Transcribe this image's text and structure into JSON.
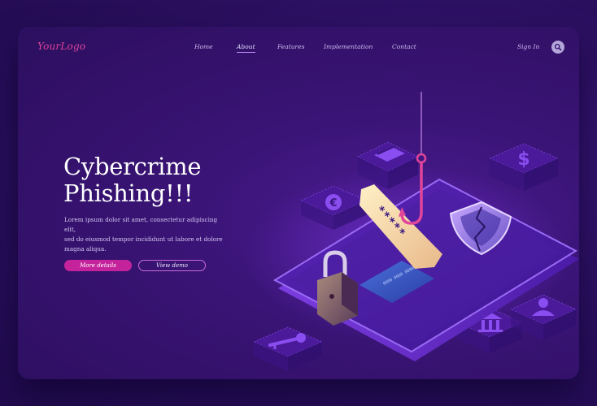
{
  "header": {
    "logo": "YourLogo",
    "nav": [
      "Home",
      "About",
      "Features",
      "Implementation",
      "Contact"
    ],
    "active_nav": "About",
    "sign_in": "Sign In"
  },
  "hero": {
    "title_line1": "Cybercrime",
    "title_line2": "Phishing!!!",
    "body_line1": "Lorem ipsum dolor sit amet, consectetur adipiscing elit,",
    "body_line2": "sed do eiusmod tempor incididunt ut labore et dolore",
    "body_line3": "magna aliqua.",
    "primary_button": "More details",
    "secondary_button": "View demo"
  },
  "illustration": {
    "password_mask": "*****",
    "icons": [
      "credit-card-icon",
      "dollar-icon",
      "euro-icon",
      "key-icon",
      "bank-icon",
      "user-icon",
      "padlock-icon",
      "broken-shield-icon",
      "fishing-hook-icon",
      "smartphone-icon"
    ]
  },
  "colors": {
    "background": "#2a0f5e",
    "card": "#3a1476",
    "accent": "#c4239c",
    "logo": "#e0459a",
    "phone": "#6a2fd0"
  }
}
